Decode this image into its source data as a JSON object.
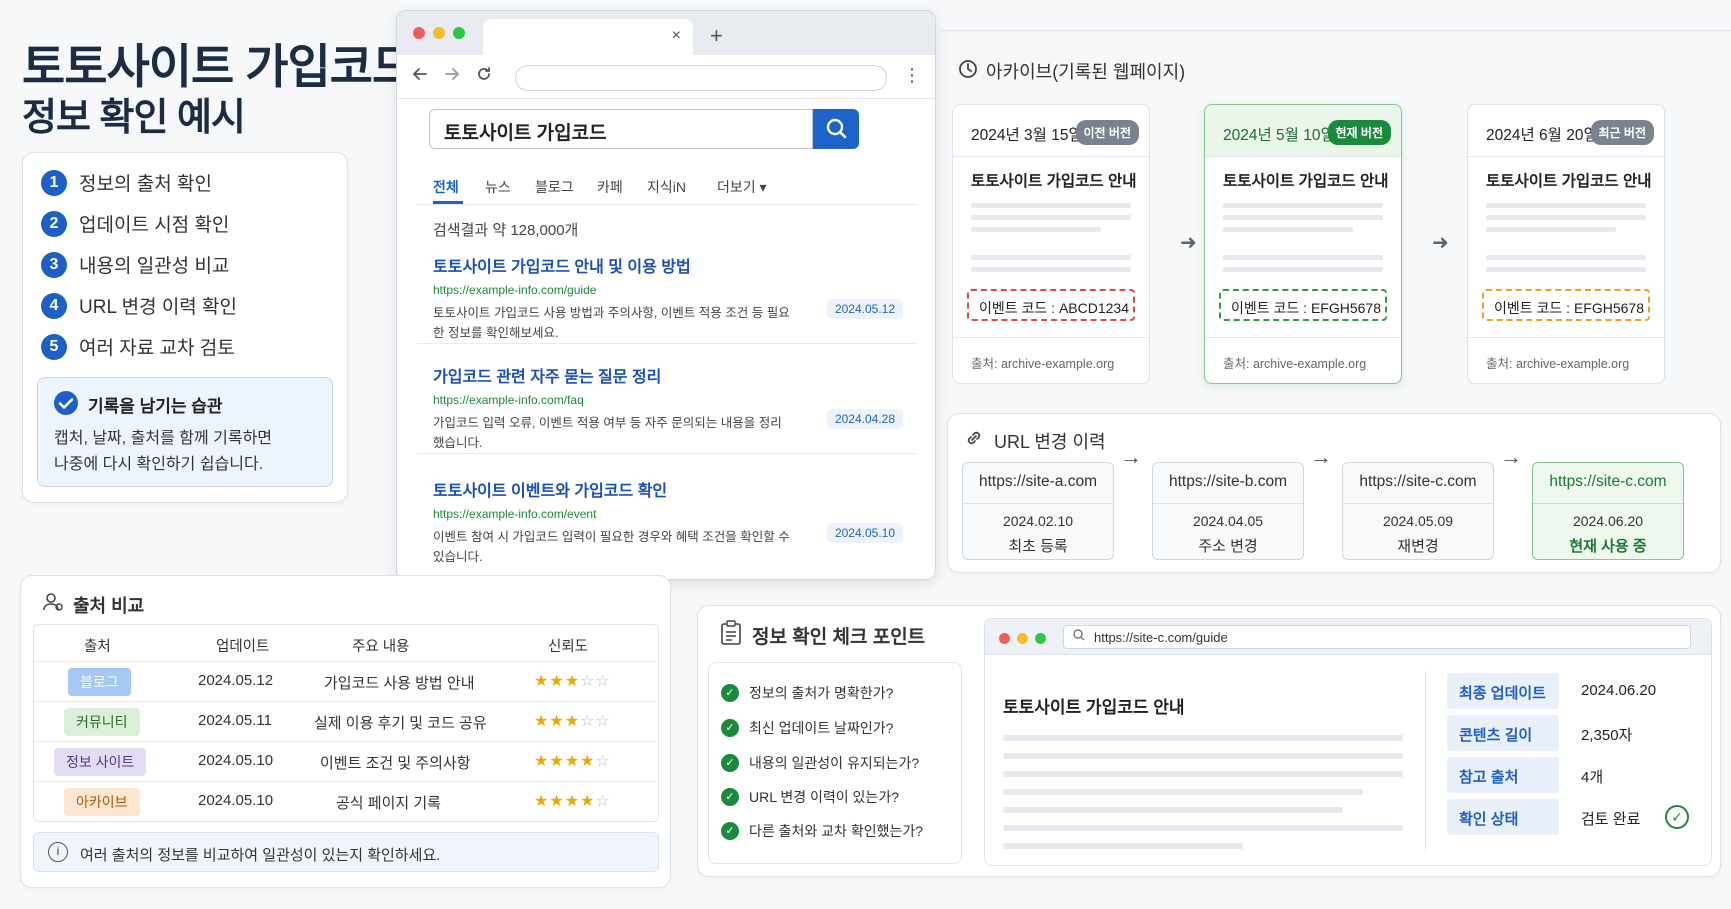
{
  "title": {
    "line1": "토토사이트 가입코드",
    "line2": "정보 확인 예시"
  },
  "steps": [
    {
      "num": "1",
      "label": "정보의 출처 확인"
    },
    {
      "num": "2",
      "label": "업데이트 시점 확인"
    },
    {
      "num": "3",
      "label": "내용의 일관성 비교"
    },
    {
      "num": "4",
      "label": "URL 변경 이력 확인"
    },
    {
      "num": "5",
      "label": "여러 자료 교차 검토"
    }
  ],
  "habit": {
    "title": "기록을 남기는 습관",
    "line1": "캡처, 날짜, 출처를 함께 기록하면",
    "line2": "나중에 다시 확인하기 쉽습니다."
  },
  "browser": {
    "tab_close": "×",
    "new_tab": "+",
    "search_query": "토토사이트 가입코드",
    "tabs": [
      "전체",
      "뉴스",
      "블로그",
      "카페",
      "지식iN",
      "더보기 ▾"
    ],
    "result_count": "검색결과 약 128,000개",
    "results": [
      {
        "title": "토토사이트 가입코드 안내 및 이용 방법",
        "url": "https://example-info.com/guide",
        "desc": "토토사이트 가입코드 사용 방법과 주의사항, 이벤트 적용 조건 등 필요한 정보를 확인해보세요.",
        "date": "2024.05.12"
      },
      {
        "title": "가입코드 관련 자주 묻는 질문 정리",
        "url": "https://example-info.com/faq",
        "desc": "가입코드 입력 오류, 이벤트 적용 여부 등 자주 문의되는 내용을 정리했습니다.",
        "date": "2024.04.28"
      },
      {
        "title": "토토사이트 이벤트와 가입코드 확인",
        "url": "https://example-info.com/event",
        "desc": "이벤트 참여 시 가입코드 입력이 필요한 경우와 혜택 조건을 확인할 수 있습니다.",
        "date": "2024.05.10"
      }
    ]
  },
  "archive": {
    "title": "아카이브(기록된 웹페이지)",
    "cards": [
      {
        "date": "2024년 3월 15일",
        "badge": "이전 버전",
        "name": "토토사이트 가입코드 안내",
        "code": "이벤트 코드 : ABCD1234",
        "source": "출처: archive-example.org",
        "badge_color": "#7a8290",
        "code_color": "#e04848"
      },
      {
        "date": "2024년 5월 10일",
        "badge": "현재 버전",
        "name": "토토사이트 가입코드 안내",
        "code": "이벤트 코드 : EFGH5678",
        "source": "출처: archive-example.org",
        "badge_color": "#1b8a3c",
        "code_color": "#2e9a4a"
      },
      {
        "date": "2024년 6월 20일",
        "badge": "최근 버전",
        "name": "토토사이트 가입코드 안내",
        "code": "이벤트 코드 : EFGH5678",
        "source": "출처: archive-example.org",
        "badge_color": "#7a8290",
        "code_color": "#f0a020"
      }
    ]
  },
  "url_history": {
    "title": "URL 변경 이력",
    "items": [
      {
        "url": "https://site-a.com",
        "date": "2024.02.10",
        "label": "최초 등록"
      },
      {
        "url": "https://site-b.com",
        "date": "2024.04.05",
        "label": "주소 변경"
      },
      {
        "url": "https://site-c.com",
        "date": "2024.05.09",
        "label": "재변경"
      },
      {
        "url": "https://site-c.com",
        "date": "2024.06.20",
        "label": "현재 사용 중"
      }
    ]
  },
  "compare": {
    "title": "출처 비교",
    "headers": [
      "출처",
      "업데이트",
      "주요 내용",
      "신뢰도"
    ],
    "rows": [
      {
        "source": "블로그",
        "date": "2024.05.12",
        "content": "가입코드 사용 방법 안내",
        "stars": 3,
        "bg": "#a6c8f4",
        "fg": "#ffffff"
      },
      {
        "source": "커뮤니티",
        "date": "2024.05.11",
        "content": "실제 이용 후기 및 코드 공유",
        "stars": 3,
        "bg": "#dcefd9",
        "fg": "#2c6b2c"
      },
      {
        "source": "정보 사이트",
        "date": "2024.05.10",
        "content": "이벤트 조건 및 주의사항",
        "stars": 4,
        "bg": "#e4dcf4",
        "fg": "#4a3a8a"
      },
      {
        "source": "아카이브",
        "date": "2024.05.10",
        "content": "공식 페이지 기록",
        "stars": 4,
        "bg": "#fde6cf",
        "fg": "#b05a10"
      }
    ],
    "note": "여러 출처의 정보를 비교하여 일관성이 있는지 확인하세요."
  },
  "checkpoint": {
    "title": "정보 확인 체크 포인트",
    "items": [
      "정보의 출처가 명확한가?",
      "최신 업데이트 날짜인가?",
      "내용의 일관성이 유지되는가?",
      "URL 변경 이력이 있는가?",
      "다른 출처와 교차 확인했는가?"
    ],
    "mini_url": "https://site-c.com/guide",
    "page_title": "토토사이트 가입코드 안내",
    "meta": [
      {
        "key": "최종 업데이트",
        "value": "2024.06.20"
      },
      {
        "key": "콘텐츠 길이",
        "value": "2,350자"
      },
      {
        "key": "참고 출처",
        "value": "4개"
      },
      {
        "key": "확인 상태",
        "value": "검토 완료"
      }
    ]
  }
}
